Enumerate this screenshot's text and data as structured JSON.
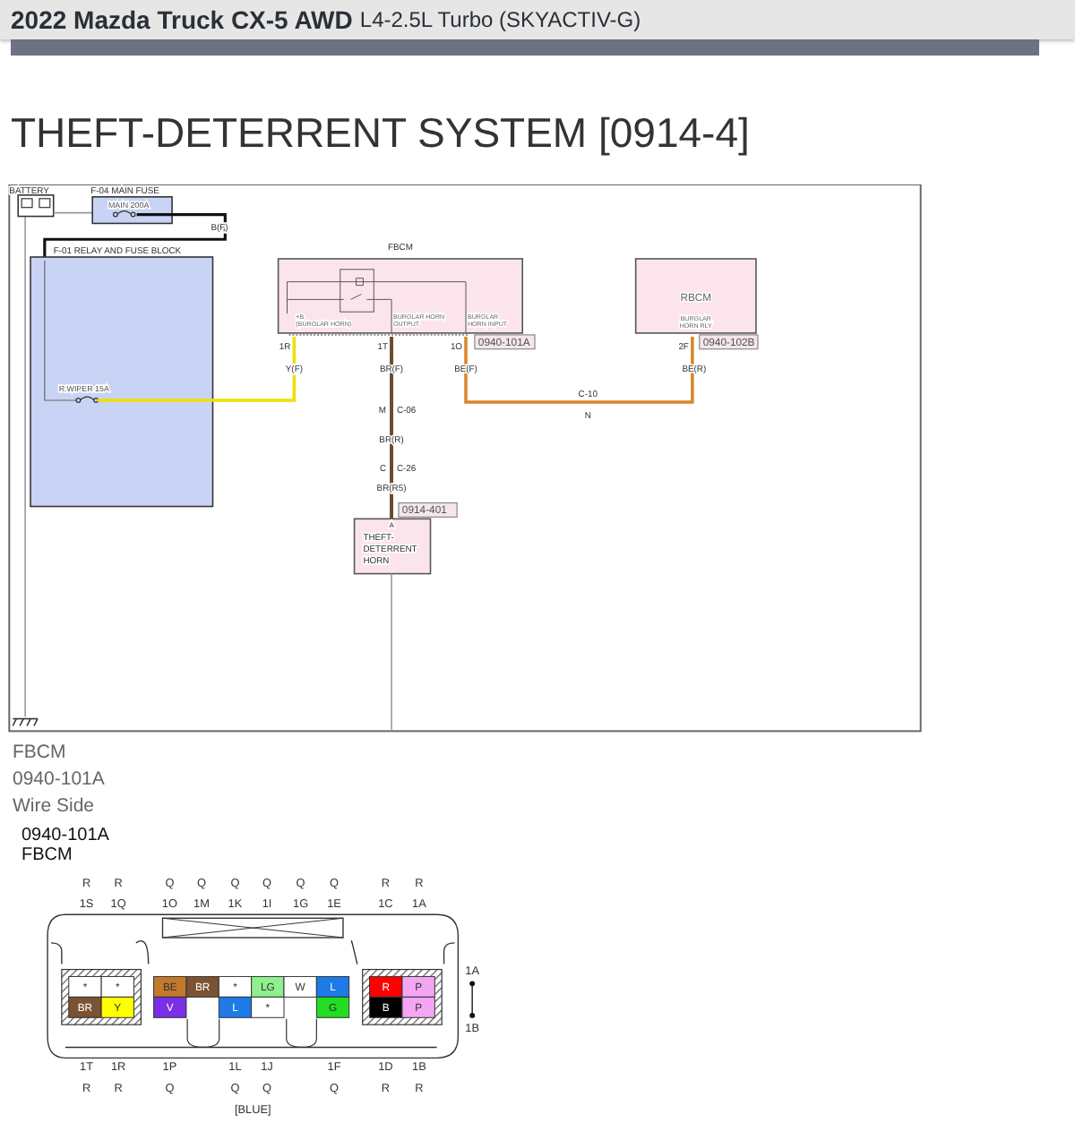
{
  "header": {
    "vehicle": "2022 Mazda Truck CX-5 AWD",
    "engine": "L4-2.5L Turbo (SKYACTIV-G)"
  },
  "title": "THEFT-DETERRENT SYSTEM [0914-4]",
  "diagram": {
    "battery": "BATTERY",
    "main_fuse": {
      "name": "F-04  MAIN FUSE",
      "rating": "MAIN 200A",
      "wire": "B(F)"
    },
    "relay_block": {
      "name": "F-01  RELAY AND FUSE BLOCK",
      "fuse": "R.WIPER 15A"
    },
    "fbcm": {
      "name": "FBCM",
      "connector": "0940-101A",
      "pins": [
        {
          "pin": "1R",
          "label": [
            "+B",
            "(BURGLAR HORN)"
          ],
          "wire": "Y(F)"
        },
        {
          "pin": "1T",
          "label": [
            "BURGLAR HORN",
            "OUTPUT"
          ],
          "wire": "BR(F)"
        },
        {
          "pin": "1O",
          "label": [
            "BURGLAR",
            "HORN INPUT"
          ],
          "wire": "BE(F)"
        }
      ]
    },
    "rbcm": {
      "name": "RBCM",
      "label": [
        "BURGLAR",
        "HORN RLY"
      ],
      "pin": "2F",
      "wire": "BE(R)",
      "connector": "0940-102B"
    },
    "joint_c10": {
      "name": "C-10",
      "pin": "N"
    },
    "joint_c06": {
      "pin": "M",
      "name": "C-06",
      "wire": "BR(R)"
    },
    "joint_c26": {
      "pin": "C",
      "name": "C-26",
      "wire": "BR(R5)"
    },
    "horn": {
      "name": [
        "THEFT-",
        "DETERRENT",
        "HORN"
      ],
      "pin": "A",
      "connector": "0914-401"
    }
  },
  "captions": [
    "FBCM",
    "0940-101A",
    "Wire Side"
  ],
  "connector_view": {
    "id": "0940-101A",
    "name": "FBCM",
    "housing": "[BLUE]",
    "jumper": [
      "1A",
      "1B"
    ],
    "top_pins": [
      {
        "wire": "R",
        "pin": "1S"
      },
      {
        "wire": "R",
        "pin": "1Q"
      },
      {
        "wire": "Q",
        "pin": "1O"
      },
      {
        "wire": "Q",
        "pin": "1M"
      },
      {
        "wire": "Q",
        "pin": "1K"
      },
      {
        "wire": "Q",
        "pin": "1I"
      },
      {
        "wire": "Q",
        "pin": "1G"
      },
      {
        "wire": "Q",
        "pin": "1E"
      },
      {
        "wire": "R",
        "pin": "1C"
      },
      {
        "wire": "R",
        "pin": "1A"
      }
    ],
    "bottom_pins": [
      {
        "pin": "1T",
        "wire": "R"
      },
      {
        "pin": "1R",
        "wire": "R"
      },
      {
        "pin": "1P",
        "wire": "Q"
      },
      {
        "pin": "1L",
        "wire": "Q"
      },
      {
        "pin": "1J",
        "wire": "Q"
      },
      {
        "pin": "1F",
        "wire": "Q"
      },
      {
        "pin": "1D",
        "wire": "R"
      },
      {
        "pin": "1B",
        "wire": "R"
      }
    ],
    "blocks": [
      {
        "rows": [
          [
            {
              "kind": "cavity",
              "label": "*",
              "color": "#ffffff"
            },
            {
              "kind": "cavity",
              "label": "*",
              "color": "#ffffff"
            }
          ],
          [
            {
              "kind": "cavity",
              "label": "BR",
              "color": "#7b5232"
            },
            {
              "kind": "cavity",
              "label": "Y",
              "color": "#ffff00"
            }
          ]
        ]
      },
      {
        "rows": [
          [
            {
              "kind": "cavity",
              "label": "BE",
              "color": "#c47a2c"
            },
            {
              "kind": "cavity",
              "label": "BR",
              "color": "#7b5232"
            },
            {
              "kind": "cavity",
              "label": "*",
              "color": "#ffffff"
            },
            {
              "kind": "cavity",
              "label": "LG",
              "color": "#8ef08e"
            },
            {
              "kind": "cavity",
              "label": "W",
              "color": "#ffffff"
            },
            {
              "kind": "cavity",
              "label": "L",
              "color": "#1e7ae6"
            }
          ],
          [
            {
              "kind": "cavity",
              "label": "V",
              "color": "#7a2ee6"
            },
            {
              "kind": "blank"
            },
            {
              "kind": "cavity",
              "label": "L",
              "color": "#1e7ae6"
            },
            {
              "kind": "cavity",
              "label": "*",
              "color": "#ffffff"
            },
            {
              "kind": "blank"
            },
            {
              "kind": "cavity",
              "label": "G",
              "color": "#22dd22"
            }
          ]
        ]
      },
      {
        "rows": [
          [
            {
              "kind": "cavity",
              "label": "R",
              "color": "#ff0000"
            },
            {
              "kind": "cavity",
              "label": "P",
              "color": "#f4a6f4"
            }
          ],
          [
            {
              "kind": "cavity",
              "label": "B",
              "color": "#000000"
            },
            {
              "kind": "cavity",
              "label": "P",
              "color": "#f4a6f4"
            }
          ]
        ]
      }
    ]
  }
}
